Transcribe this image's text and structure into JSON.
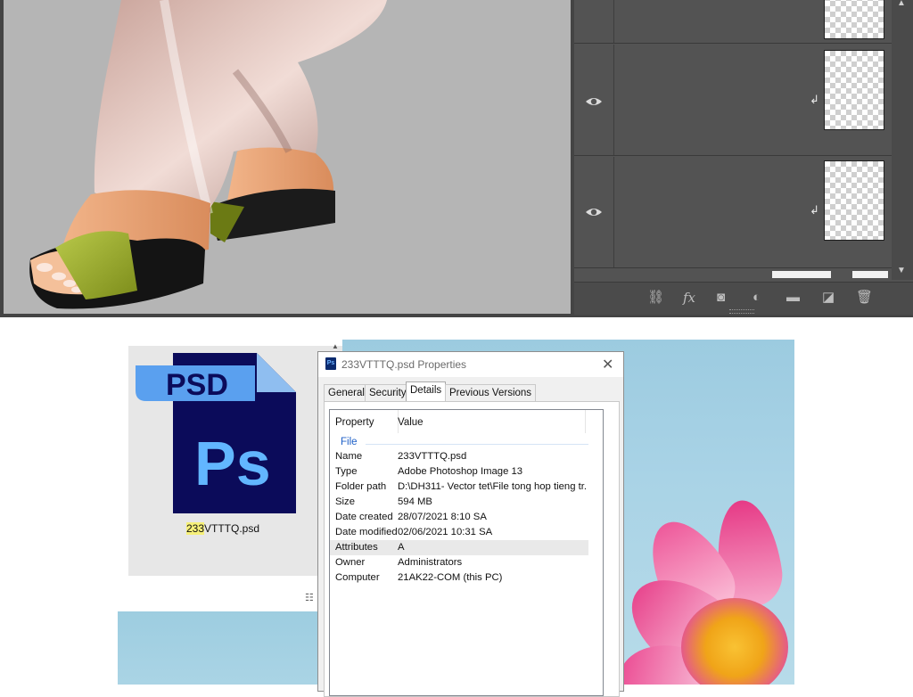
{
  "photoshop": {
    "layers": [
      {
        "visible": false,
        "clipped": false
      },
      {
        "visible": true,
        "clipped": true
      },
      {
        "visible": true,
        "clipped": true
      }
    ],
    "bottom_tools": [
      "link-icon",
      "fx-icon",
      "mask-icon",
      "adjustment-icon",
      "folder-icon",
      "new-layer-icon",
      "trash-icon"
    ],
    "fx_label": "fx"
  },
  "explorer": {
    "file_icon": {
      "banner_text": "PSD",
      "app_text": "Ps"
    },
    "file_name_highlight": "233",
    "file_name_rest": "VTTTQ.psd"
  },
  "dialog": {
    "title": "233VTTTQ.psd Properties",
    "close_glyph": "✕",
    "tabs": [
      {
        "label": "General",
        "active": false
      },
      {
        "label": "Security",
        "active": false
      },
      {
        "label": "Details",
        "active": true
      },
      {
        "label": "Previous Versions",
        "active": false
      }
    ],
    "columns": {
      "property": "Property",
      "value": "Value"
    },
    "group": "File",
    "rows": [
      {
        "key": "Name",
        "value": "233VTTTQ.psd"
      },
      {
        "key": "Type",
        "value": "Adobe Photoshop Image 13"
      },
      {
        "key": "Folder path",
        "value": "D:\\DH311- Vector tet\\File tong hop tieng tr..."
      },
      {
        "key": "Size",
        "value": "594 MB"
      },
      {
        "key": "Date created",
        "value": "28/07/2021 8:10 SA"
      },
      {
        "key": "Date modified",
        "value": "02/06/2021 10:31 SA"
      },
      {
        "key": "Attributes",
        "value": "A"
      },
      {
        "key": "Owner",
        "value": "Administrators"
      },
      {
        "key": "Computer",
        "value": "21AK22-COM (this PC)"
      }
    ],
    "selected_row": 6
  },
  "colors": {
    "ps_panel": "#535353",
    "canvas": "#b5b5b5",
    "sky": "#a9d3e6",
    "link_blue": "#1d5fc7"
  }
}
